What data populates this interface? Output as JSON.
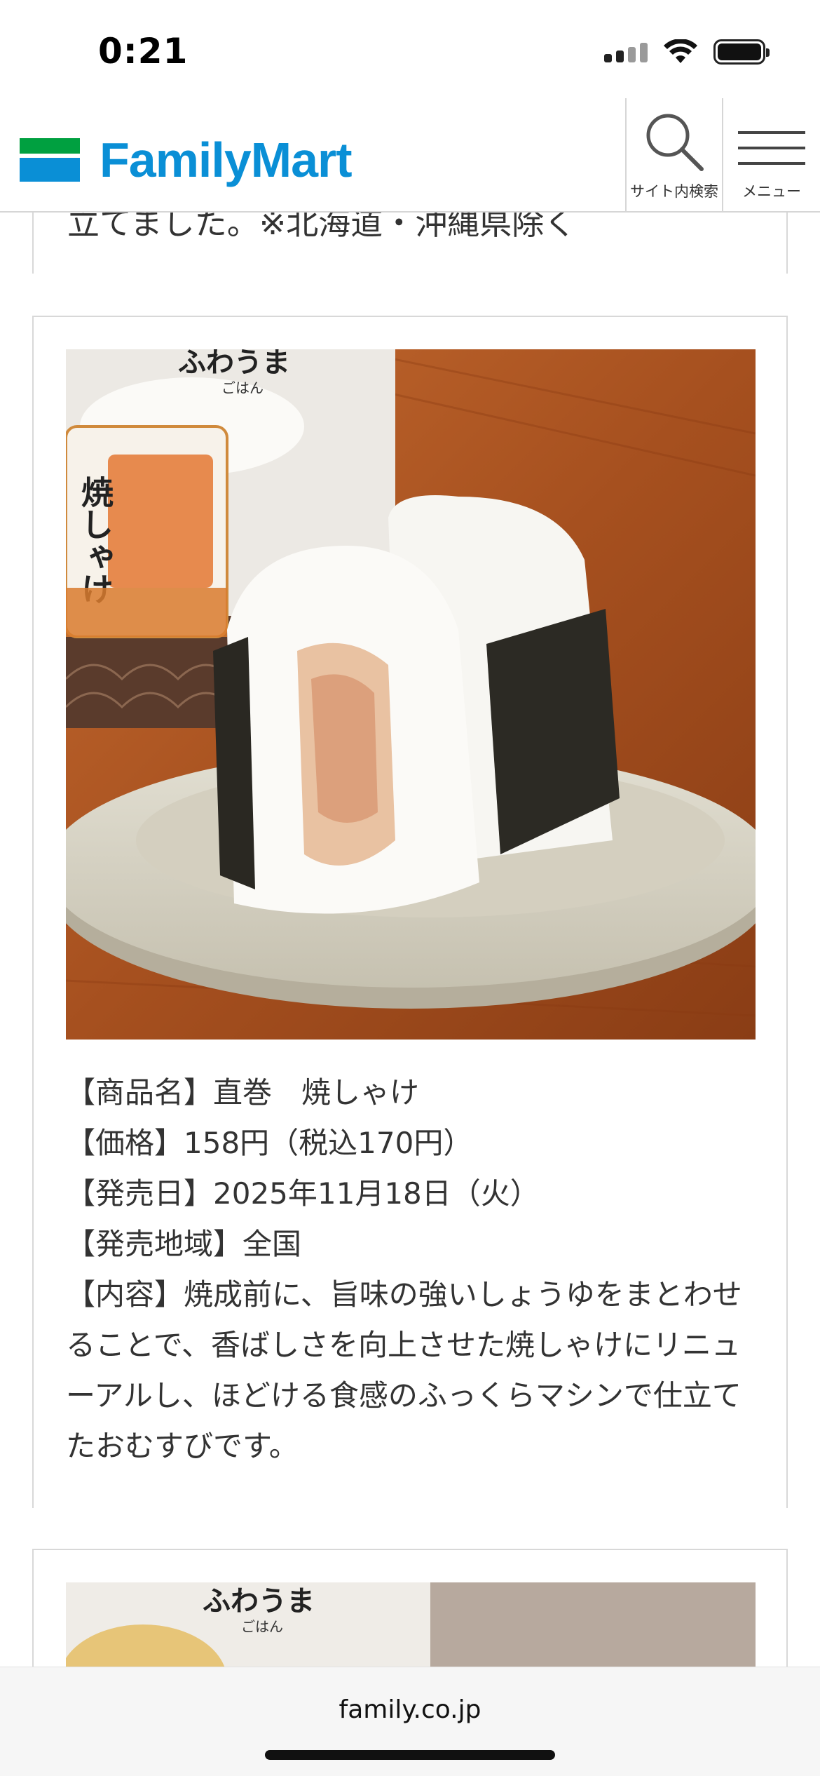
{
  "status_bar": {
    "time": "0:21"
  },
  "header": {
    "logo_text": "FamilyMart",
    "search_label": "サイト内検索",
    "menu_label": "メニュー"
  },
  "previous_card": {
    "trailing_text": "立てました。※北海道・沖縄県除く"
  },
  "product": {
    "name_line": "【商品名】直巻　焼しゃけ",
    "price_line": "【価格】158円（税込170円）",
    "date_line": "【発売日】2025年11月18日（火）",
    "region_line": "【発売地域】全国",
    "description_line": "【内容】焼成前に、旨味の強いしょうゆをまとわせることで、香ばしさを向上させた焼しゃけにリニューアルし、ほどける食感のふっくらマシンで仕立てたおむすびです。",
    "package_brand": "ふわうま",
    "package_sub": "ごはん",
    "package_title": "焼しゃけ"
  },
  "next_card": {
    "package_brand": "ふわうま",
    "package_sub": "ごはん"
  },
  "browser": {
    "url": "family.co.jp"
  },
  "colors": {
    "brand_blue": "#0a8fd6",
    "brand_green": "#00a040",
    "text": "#333333",
    "border": "#d8d8d8"
  },
  "icons": [
    "signal-icon",
    "wifi-icon",
    "battery-icon",
    "search-icon",
    "hamburger-menu-icon"
  ]
}
